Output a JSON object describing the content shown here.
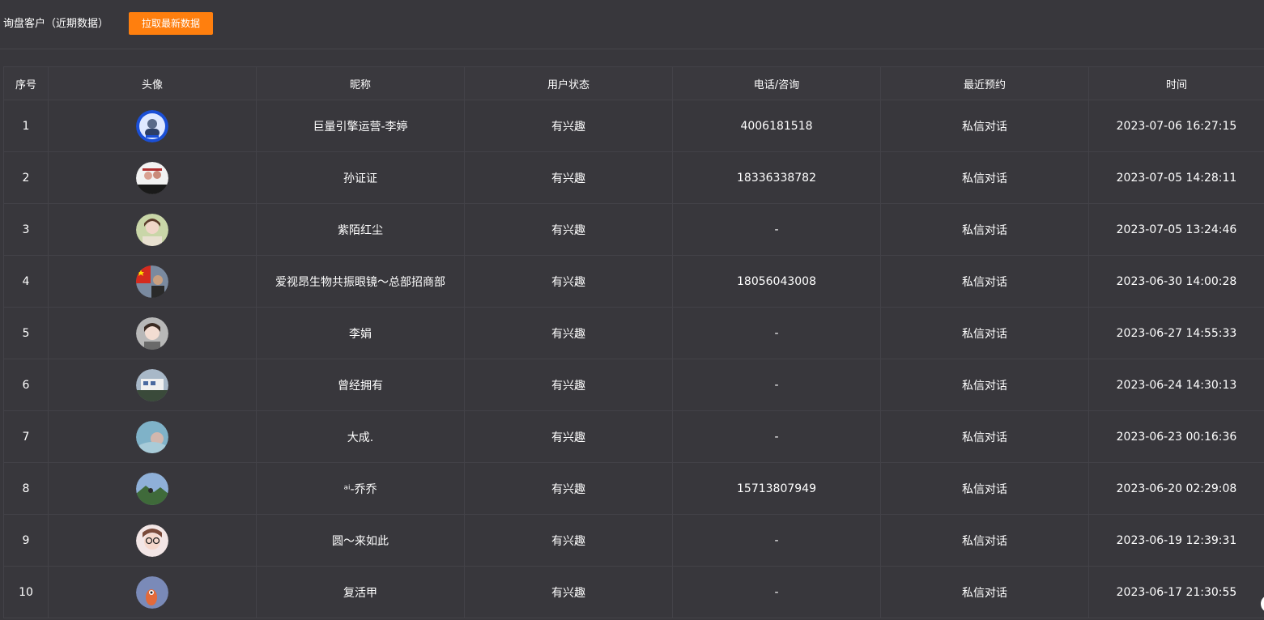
{
  "header": {
    "title": "询盘客户（近期数据）",
    "refresh_label": "拉取最新数据",
    "accent_color": "#ff7f0e"
  },
  "table": {
    "columns": [
      "序号",
      "头像",
      "昵称",
      "用户状态",
      "电话/咨询",
      "最近预约",
      "时间"
    ],
    "rows": [
      {
        "index": "1",
        "avatar": "avatar-blue-ring",
        "nickname": "巨量引擎运营-李婷",
        "status": "有兴趣",
        "phone": "4006181518",
        "recent": "私信对话",
        "time": "2023-07-06 16:27:15"
      },
      {
        "index": "2",
        "avatar": "avatar-comic",
        "nickname": "孙证证",
        "status": "有兴趣",
        "phone": "18336338782",
        "recent": "私信对话",
        "time": "2023-07-05 14:28:11"
      },
      {
        "index": "3",
        "avatar": "avatar-woman",
        "nickname": "紫陌红尘",
        "status": "有兴趣",
        "phone": "-",
        "recent": "私信对话",
        "time": "2023-07-05 13:24:46"
      },
      {
        "index": "4",
        "avatar": "avatar-flag",
        "nickname": "爱视昂生物共振眼镜～总部招商部",
        "status": "有兴趣",
        "phone": "18056043008",
        "recent": "私信对话",
        "time": "2023-06-30 14:00:28"
      },
      {
        "index": "5",
        "avatar": "avatar-girl",
        "nickname": "李娟",
        "status": "有兴趣",
        "phone": "-",
        "recent": "私信对话",
        "time": "2023-06-27 14:55:33"
      },
      {
        "index": "6",
        "avatar": "avatar-building",
        "nickname": "曾经拥有",
        "status": "有兴趣",
        "phone": "-",
        "recent": "私信对话",
        "time": "2023-06-24 14:30:13"
      },
      {
        "index": "7",
        "avatar": "avatar-sky",
        "nickname": "大成.",
        "status": "有兴趣",
        "phone": "-",
        "recent": "私信对话",
        "time": "2023-06-23 00:16:36"
      },
      {
        "index": "8",
        "avatar": "avatar-landscape",
        "nickname": "ᵃⁱ-乔乔",
        "status": "有兴趣",
        "phone": "15713807949",
        "recent": "私信对话",
        "time": "2023-06-20 02:29:08"
      },
      {
        "index": "9",
        "avatar": "avatar-glasses",
        "nickname": "圆～来如此",
        "status": "有兴趣",
        "phone": "-",
        "recent": "私信对话",
        "time": "2023-06-19 12:39:31"
      },
      {
        "index": "10",
        "avatar": "avatar-cartoon",
        "nickname": "复活甲",
        "status": "有兴趣",
        "phone": "-",
        "recent": "私信对话",
        "time": "2023-06-17 21:30:55"
      }
    ]
  }
}
